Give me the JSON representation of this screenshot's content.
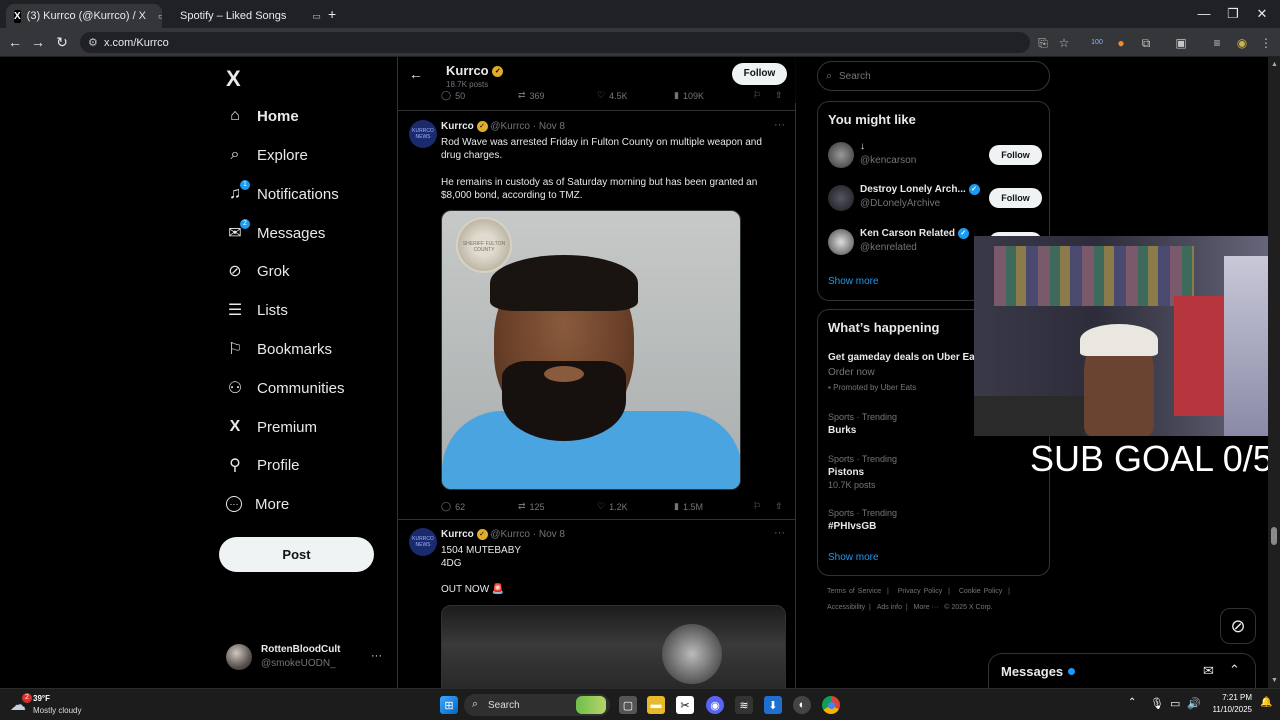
{
  "browser": {
    "tabs": [
      {
        "title": "(3) Kurrco (@Kurrco) / X",
        "active": true
      },
      {
        "title": "Spotify – Liked Songs",
        "active": false
      }
    ],
    "url": "x.com/Kurrco",
    "window_controls": {
      "minimize": "—",
      "restore": "❐",
      "close": "✕"
    },
    "extension_badge": "100"
  },
  "sidebar": {
    "logo": "X",
    "items": [
      {
        "label": "Home",
        "icon": "home-icon",
        "glyph": "⌂",
        "badge": ""
      },
      {
        "label": "Explore",
        "icon": "search-icon",
        "glyph": "⌕",
        "badge": ""
      },
      {
        "label": "Notifications",
        "icon": "bell-icon",
        "glyph": "🔔",
        "badge": "1"
      },
      {
        "label": "Messages",
        "icon": "mail-icon",
        "glyph": "✉",
        "badge": "2"
      },
      {
        "label": "Grok",
        "icon": "grok-icon",
        "glyph": "⊘",
        "badge": ""
      },
      {
        "label": "Lists",
        "icon": "lists-icon",
        "glyph": "☰",
        "badge": ""
      },
      {
        "label": "Bookmarks",
        "icon": "bookmark-icon",
        "glyph": "🔖",
        "badge": ""
      },
      {
        "label": "Communities",
        "icon": "communities-icon",
        "glyph": "👥",
        "badge": ""
      },
      {
        "label": "Premium",
        "icon": "x-premium-icon",
        "glyph": "X",
        "badge": ""
      },
      {
        "label": "Profile",
        "icon": "profile-icon",
        "glyph": "👤",
        "badge": ""
      },
      {
        "label": "More",
        "icon": "more-circle-icon",
        "glyph": "⋯",
        "badge": ""
      }
    ],
    "post_label": "Post",
    "account": {
      "name": "RottenBloodCult",
      "handle": "@smokeUODN_",
      "menu": "···"
    }
  },
  "profile_header": {
    "name": "Kurrco",
    "posts": "18.7K posts",
    "follow_label": "Follow"
  },
  "top_actions": {
    "replies": "50",
    "reposts": "369",
    "likes": "4.5K",
    "views": "109K"
  },
  "tweets": [
    {
      "name": "Kurrco",
      "handle": "@Kurrco",
      "date": "Nov 8",
      "avatar_text": "KURRCO NEWS",
      "text1": "Rod Wave was arrested Friday in Fulton County on multiple weapon and drug charges.",
      "text2": "He remains in custody as of Saturday morning but has been granted an $8,000 bond, according to TMZ.",
      "seal_text": "SHERIFF FULTON COUNTY",
      "replies": "62",
      "reposts": "125",
      "likes": "1.2K",
      "views": "1.5M",
      "menu": "···"
    },
    {
      "name": "Kurrco",
      "handle": "@Kurrco",
      "date": "Nov 8",
      "avatar_text": "KURRCO NEWS",
      "line1": "1504 MUTEBABY",
      "line2": "4DG",
      "line3": "OUT NOW 🚨",
      "menu": "···"
    }
  ],
  "right": {
    "search_placeholder": "Search",
    "you_might_like": {
      "title": "You might like",
      "people": [
        {
          "name": "↓",
          "handle": "@kencarson",
          "verified": false,
          "follow": "Follow"
        },
        {
          "name": "Destroy Lonely Arch...",
          "handle": "@DLonelyArchive",
          "verified": true,
          "follow": "Follow"
        },
        {
          "name": "Ken Carson Related",
          "handle": "@kenrelated",
          "verified": true,
          "follow": "Follow"
        }
      ],
      "show_more": "Show more"
    },
    "whats_happening": {
      "title": "What’s happening",
      "promo_title": "Get gameday deals on Uber Ea",
      "promo_sub": "Order now",
      "promo_by": "Promoted by Uber Eats",
      "trends": [
        {
          "category": "Sports · Trending",
          "name": "Burks",
          "posts": ""
        },
        {
          "category": "Sports · Trending",
          "name": "Pistons",
          "posts": "10.7K posts"
        },
        {
          "category": "Sports · Trending",
          "name": "#PHIvsGB",
          "posts": ""
        }
      ],
      "show_more": "Show more"
    },
    "footer": {
      "links": [
        "Terms of Service",
        "|",
        "Privacy Policy",
        "|",
        "Cookie Policy",
        "|"
      ],
      "links2": [
        "Accessibility",
        "|",
        "Ads info",
        "|",
        "More ···",
        "© 2025 X Corp."
      ]
    }
  },
  "overlay": {
    "sub_goal": "SUB GOAL 0/5"
  },
  "messages_dock": {
    "label": "Messages"
  },
  "taskbar": {
    "weather_temp": "39°F",
    "weather_desc": "Mostly cloudy",
    "weather_badge": "2",
    "search_label": "Search",
    "time": "7:21 PM",
    "date": "11/10/2025"
  }
}
